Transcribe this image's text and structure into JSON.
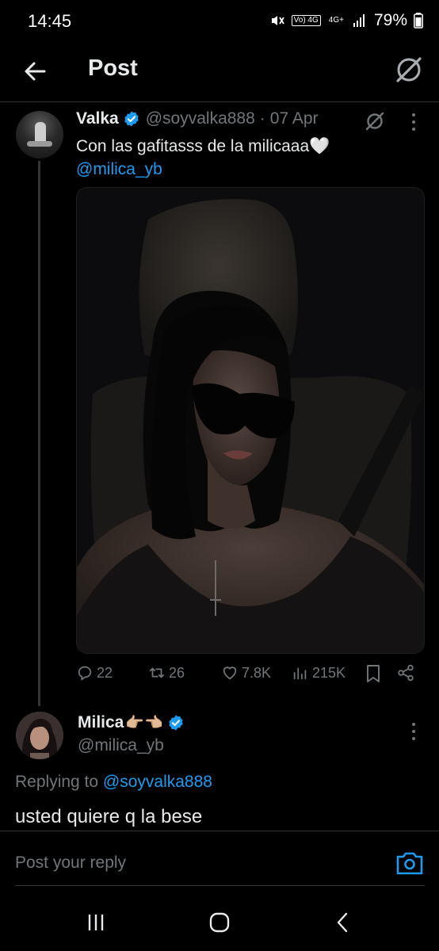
{
  "status_bar": {
    "time": "14:45",
    "network_1": "Vo) 4G",
    "network_2": "4G+",
    "battery": "79%",
    "icons": [
      "mute-icon",
      "volte-icon",
      "signal-icon",
      "battery-icon"
    ]
  },
  "header": {
    "title": "Post",
    "back_icon": "arrow-left-icon",
    "grok_icon": "grok-icon"
  },
  "post": {
    "author_name": "Valka",
    "author_handle": "@soyvalka888",
    "separator": "·",
    "date": "07 Apr",
    "text": "Con las gafitasss de la milicaaa🤍",
    "mention": "@milica_yb",
    "image_icon": "photo",
    "stats": {
      "replies": "22",
      "reposts": "26",
      "likes": "7.8K",
      "views": "215K"
    }
  },
  "reply": {
    "author_name": "Milica",
    "author_emoji": "👉🏼👈🏼",
    "author_handle": "@milica_yb",
    "replying_prefix": "Replying to",
    "replying_to": "@soyvalka888",
    "text": "usted quiere q la bese"
  },
  "composer": {
    "placeholder": "Post your reply"
  },
  "colors": {
    "background": "#000000",
    "text_primary": "#e7e9ea",
    "text_secondary": "#71767b",
    "accent": "#1d9bf0",
    "divider": "#2f3336"
  }
}
